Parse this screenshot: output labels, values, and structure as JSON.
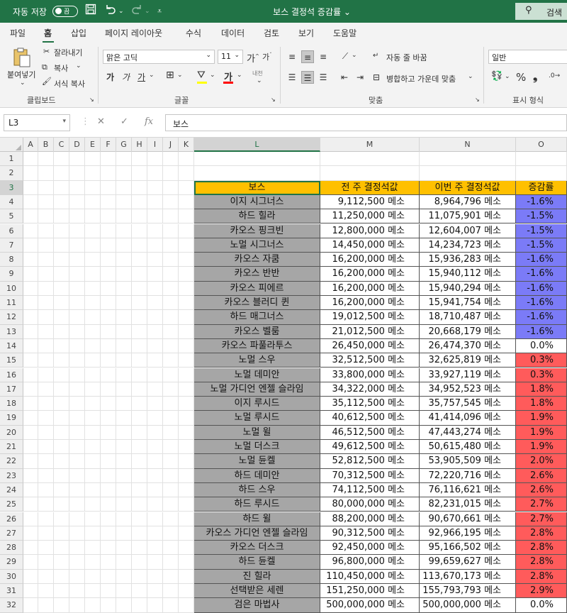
{
  "titlebar": {
    "autosave_label": "자동 저장",
    "autosave_state": "끔",
    "doc_title": "보스 결정석 증감률 ⌄",
    "search_label": "검색"
  },
  "tabs": [
    "파일",
    "홈",
    "삽입",
    "페이지 레이아웃",
    "수식",
    "데이터",
    "검토",
    "보기",
    "도움말"
  ],
  "active_tab": "홈",
  "ribbon": {
    "paste": "붙여넣기",
    "cut": "잘라내기",
    "copy": "복사",
    "format_painter": "서식 복사",
    "clipboard": "클립보드",
    "font_name": "맑은 고딕",
    "font_size": "11",
    "font_group": "글꼴",
    "wrap_text": "자동 줄 바꿈",
    "merge_center": "병합하고 가운데 맞춤",
    "align_group": "맞춤",
    "number_format": "일반",
    "number_group": "표시 형식"
  },
  "formula_bar": {
    "name_box": "L3",
    "formula": "보스"
  },
  "columns": [
    "A",
    "B",
    "C",
    "D",
    "E",
    "F",
    "G",
    "H",
    "I",
    "J",
    "K",
    "L",
    "M",
    "N",
    "O"
  ],
  "row_numbers": [
    "1",
    "2",
    "3",
    "4",
    "5",
    "6",
    "7",
    "8",
    "9",
    "10",
    "11",
    "12",
    "13",
    "14",
    "15",
    "16",
    "17",
    "18",
    "19",
    "20",
    "21",
    "22",
    "23",
    "24",
    "25",
    "26",
    "27",
    "28",
    "29",
    "30",
    "31",
    "32"
  ],
  "table": {
    "headers": [
      "보스",
      "전 주 결정석값",
      "이번 주 결정석값",
      "증감률"
    ],
    "unit": "메소",
    "rows": [
      {
        "boss": "이지 시그너스",
        "prev": "9,112,500",
        "curr": "8,964,796",
        "pct": "-1.6%"
      },
      {
        "boss": "하드 힐라",
        "prev": "11,250,000",
        "curr": "11,075,901",
        "pct": "-1.5%"
      },
      {
        "boss": "카오스 핑크빈",
        "prev": "12,800,000",
        "curr": "12,604,007",
        "pct": "-1.5%"
      },
      {
        "boss": "노멀 시그너스",
        "prev": "14,450,000",
        "curr": "14,234,723",
        "pct": "-1.5%"
      },
      {
        "boss": "카오스 자쿰",
        "prev": "16,200,000",
        "curr": "15,936,283",
        "pct": "-1.6%"
      },
      {
        "boss": "카오스 반반",
        "prev": "16,200,000",
        "curr": "15,940,112",
        "pct": "-1.6%"
      },
      {
        "boss": "카오스 피에르",
        "prev": "16,200,000",
        "curr": "15,940,294",
        "pct": "-1.6%"
      },
      {
        "boss": "카오스 블러디 퀸",
        "prev": "16,200,000",
        "curr": "15,941,754",
        "pct": "-1.6%"
      },
      {
        "boss": "하드 매그너스",
        "prev": "19,012,500",
        "curr": "18,710,487",
        "pct": "-1.6%"
      },
      {
        "boss": "카오스 벨룸",
        "prev": "21,012,500",
        "curr": "20,668,179",
        "pct": "-1.6%"
      },
      {
        "boss": "카오스 파풀라투스",
        "prev": "26,450,000",
        "curr": "26,474,370",
        "pct": "0.0%"
      },
      {
        "boss": "노멀 스우",
        "prev": "32,512,500",
        "curr": "32,625,819",
        "pct": "0.3%"
      },
      {
        "boss": "노멀 데미안",
        "prev": "33,800,000",
        "curr": "33,927,119",
        "pct": "0.3%"
      },
      {
        "boss": "노멀 가디언 엔젤 슬라임",
        "prev": "34,322,000",
        "curr": "34,952,523",
        "pct": "1.8%"
      },
      {
        "boss": "이지 루시드",
        "prev": "35,112,500",
        "curr": "35,757,545",
        "pct": "1.8%"
      },
      {
        "boss": "노멀 루시드",
        "prev": "40,612,500",
        "curr": "41,414,096",
        "pct": "1.9%"
      },
      {
        "boss": "노멀 윌",
        "prev": "46,512,500",
        "curr": "47,443,274",
        "pct": "1.9%"
      },
      {
        "boss": "노멀 더스크",
        "prev": "49,612,500",
        "curr": "50,615,480",
        "pct": "1.9%"
      },
      {
        "boss": "노멀 듄켈",
        "prev": "52,812,500",
        "curr": "53,905,509",
        "pct": "2.0%"
      },
      {
        "boss": "하드 데미안",
        "prev": "70,312,500",
        "curr": "72,220,716",
        "pct": "2.6%"
      },
      {
        "boss": "하드 스우",
        "prev": "74,112,500",
        "curr": "76,116,621",
        "pct": "2.6%"
      },
      {
        "boss": "하드 루시드",
        "prev": "80,000,000",
        "curr": "82,231,015",
        "pct": "2.7%"
      },
      {
        "boss": "하드 윌",
        "prev": "88,200,000",
        "curr": "90,670,661",
        "pct": "2.7%"
      },
      {
        "boss": "카오스 가디언 엔젤 슬라임",
        "prev": "90,312,500",
        "curr": "92,966,195",
        "pct": "2.8%"
      },
      {
        "boss": "카오스 더스크",
        "prev": "92,450,000",
        "curr": "95,166,502",
        "pct": "2.8%"
      },
      {
        "boss": "하드 듄켈",
        "prev": "96,800,000",
        "curr": "99,659,627",
        "pct": "2.8%"
      },
      {
        "boss": "진 힐라",
        "prev": "110,450,000",
        "curr": "113,670,173",
        "pct": "2.8%"
      },
      {
        "boss": "선택받은 세렌",
        "prev": "151,250,000",
        "curr": "155,793,793",
        "pct": "2.9%"
      },
      {
        "boss": "검은 마법사",
        "prev": "500,000,000",
        "curr": "500,000,000",
        "pct": "0.0%"
      }
    ]
  },
  "colors": {
    "header_bg": "#ffc000",
    "name_bg": "#a6a6a6",
    "decrease_bg": "#7b7bf7",
    "increase_bg": "#ff5b5b",
    "neutral_bg": "#ffffff",
    "accent": "#217346"
  }
}
